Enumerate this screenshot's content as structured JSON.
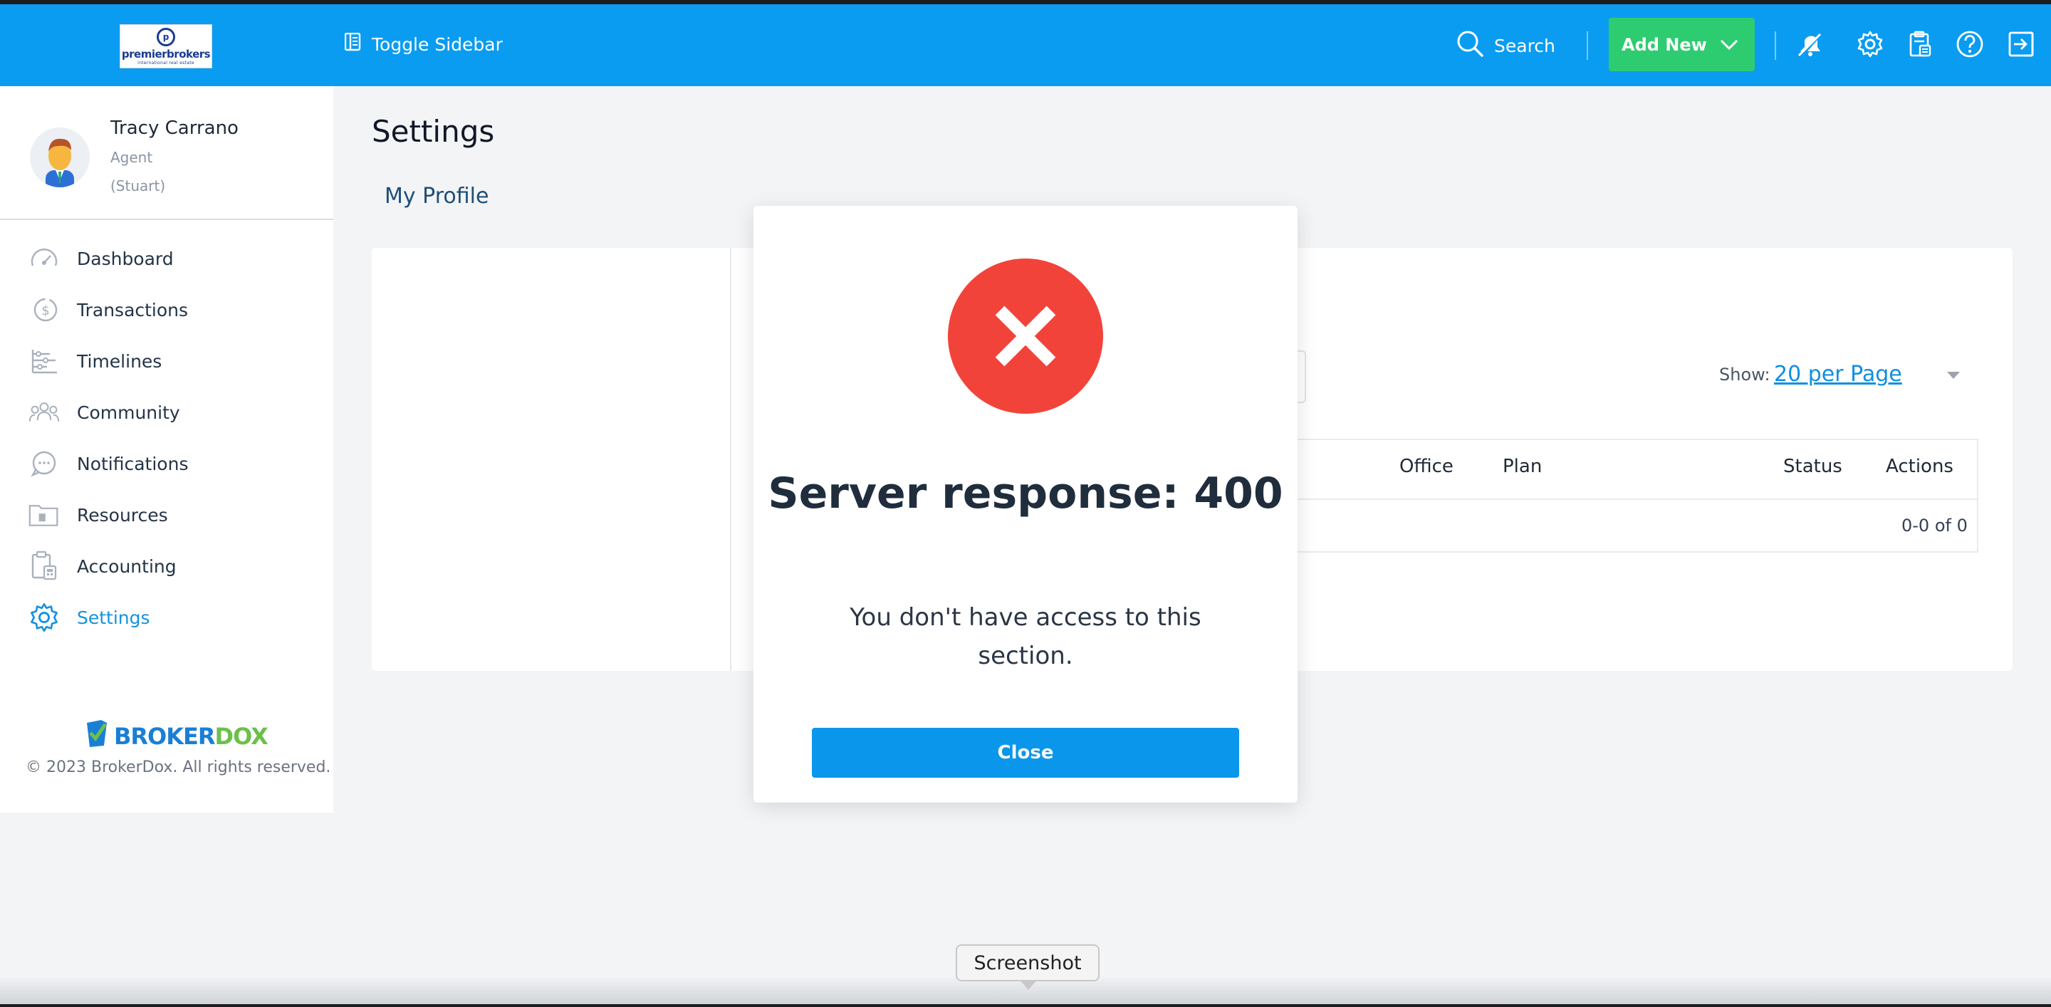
{
  "topbar": {
    "logo": {
      "brand": "premierbrokers",
      "tagline": "international real estate",
      "mark": "p"
    },
    "toggle_sidebar": "Toggle Sidebar",
    "search": "Search",
    "add_new": "Add New",
    "icons": [
      "notifications-off-icon",
      "gear-icon",
      "clipboard-icon",
      "help-icon",
      "logout-icon"
    ],
    "accent_color": "#0a9cf0",
    "add_new_color": "#2dcc70"
  },
  "sidebar": {
    "user": {
      "name": "Tracy Carrano",
      "role": "Agent",
      "office": "(Stuart)"
    },
    "items": [
      {
        "label": "Dashboard",
        "icon": "speedometer-icon"
      },
      {
        "label": "Transactions",
        "icon": "dollar-circle-icon"
      },
      {
        "label": "Timelines",
        "icon": "timeline-icon"
      },
      {
        "label": "Community",
        "icon": "people-icon"
      },
      {
        "label": "Notifications",
        "icon": "chat-bubble-icon"
      },
      {
        "label": "Resources",
        "icon": "folder-icon"
      },
      {
        "label": "Accounting",
        "icon": "calculator-icon"
      },
      {
        "label": "Settings",
        "icon": "gear-icon",
        "active": true
      }
    ],
    "footer": {
      "logo_part1": "BROKER",
      "logo_part2": "DOX",
      "copyright": "© 2023 BrokerDox. All rights reserved."
    }
  },
  "main": {
    "title": "Settings",
    "tab": "My Profile",
    "show_label": "Show:",
    "show_value": "20 per Page",
    "columns": [
      "Office",
      "Plan",
      "Status",
      "Actions"
    ],
    "pager": "0-0 of 0"
  },
  "modal": {
    "title": "Server response: 400",
    "message": "You don't have access to this section.",
    "close": "Close",
    "error_color": "#f2433b"
  },
  "tooltip": {
    "text": "Screenshot"
  }
}
